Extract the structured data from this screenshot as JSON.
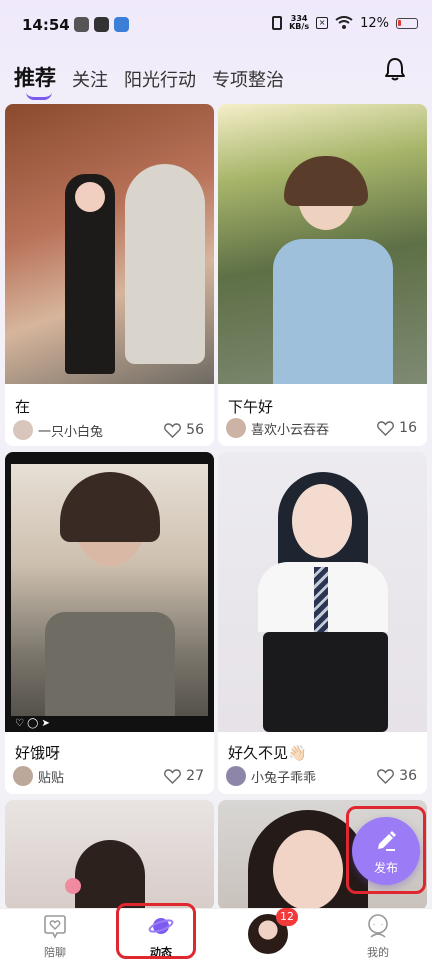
{
  "status_bar": {
    "time": "14:54",
    "net_speed_value": "334",
    "net_speed_unit": "KB/s",
    "battery_percent": "12%"
  },
  "tabs": [
    {
      "label": "推荐",
      "active": true
    },
    {
      "label": "关注",
      "active": false
    },
    {
      "label": "阳光行动",
      "active": false
    },
    {
      "label": "专项整治",
      "active": false
    }
  ],
  "feed": [
    {
      "title": "在",
      "author": "一只小白兔",
      "likes": "56"
    },
    {
      "title": "下午好",
      "author": "喜欢小云吞吞",
      "likes": "16"
    },
    {
      "title": "好饿呀",
      "author": "贴贴",
      "likes": "27"
    },
    {
      "title": "好久不见👋🏻",
      "author": "小兔子乖乖",
      "likes": "36"
    }
  ],
  "fab": {
    "label": "发布"
  },
  "bottom_nav": {
    "items": [
      {
        "label": "陪聊"
      },
      {
        "label": "动态"
      },
      {
        "label": "我的"
      }
    ],
    "badge_count": "12"
  },
  "colors": {
    "accent": "#7c5cf0",
    "fab": "#9b7cf6",
    "highlight": "#e0262e",
    "badge": "#f23a3a"
  }
}
